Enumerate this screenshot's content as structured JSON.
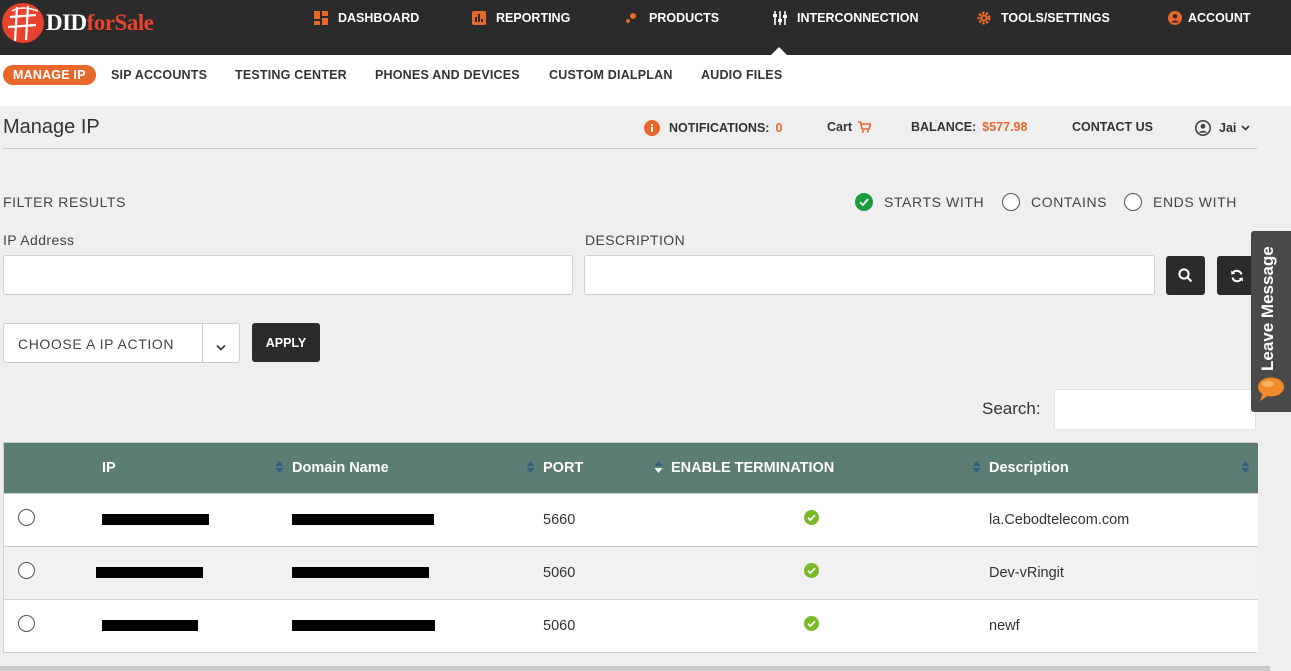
{
  "brand": {
    "did": "DID",
    "for_sale": "forSale"
  },
  "top_nav": {
    "dashboard": "DASHBOARD",
    "reporting": "REPORTING",
    "products": "PRODUCTS",
    "interconnection": "INTERCONNECTION",
    "tools_settings": "TOOLS/SETTINGS",
    "account": "ACCOUNT"
  },
  "sub_nav": {
    "manage_ip": "MANAGE IP",
    "sip_accounts": "SIP ACCOUNTS",
    "testing_center": "TESTING CENTER",
    "phones_devices": "PHONES AND DEVICES",
    "custom_dialplan": "CUSTOM DIALPLAN",
    "audio_files": "AUDIO FILES"
  },
  "page": {
    "title": "Manage IP"
  },
  "utility": {
    "notifications_label": "NOTIFICATIONS:",
    "notifications_count": "0",
    "cart": "Cart",
    "balance_label": "BALANCE:",
    "balance_value": "$577.98",
    "contact": "CONTACT US",
    "user": "Jai"
  },
  "filter": {
    "title": "FILTER RESULTS",
    "starts_with": "STARTS WITH",
    "contains": "CONTAINS",
    "ends_with": "ENDS WITH",
    "selected": "STARTS WITH",
    "ip_label": "IP Address",
    "ip_value": "",
    "desc_label": "DESCRIPTION",
    "desc_value": ""
  },
  "actions": {
    "select_label": "CHOOSE A IP ACTION",
    "apply": "APPLY"
  },
  "search": {
    "label": "Search:",
    "value": ""
  },
  "table": {
    "headers": {
      "ip": "IP",
      "domain": "Domain Name",
      "port": "PORT",
      "enable_termination": "ENABLE TERMINATION",
      "description": "Description"
    },
    "rows": [
      {
        "port": "5660",
        "termination": true,
        "description": "la.Cebodtelecom.com"
      },
      {
        "port": "5060",
        "termination": true,
        "description": "Dev-vRingit"
      },
      {
        "port": "5060",
        "termination": true,
        "description": "newf"
      }
    ]
  },
  "side_widget": {
    "label": "Leave Message"
  },
  "colors": {
    "topbar": "#2b2b2b",
    "accent_orange": "#e8672a",
    "brand_red": "#e8432e",
    "table_header": "#5b7d74",
    "check_green": "#7ab929",
    "radio_green": "#1a9b3d"
  }
}
